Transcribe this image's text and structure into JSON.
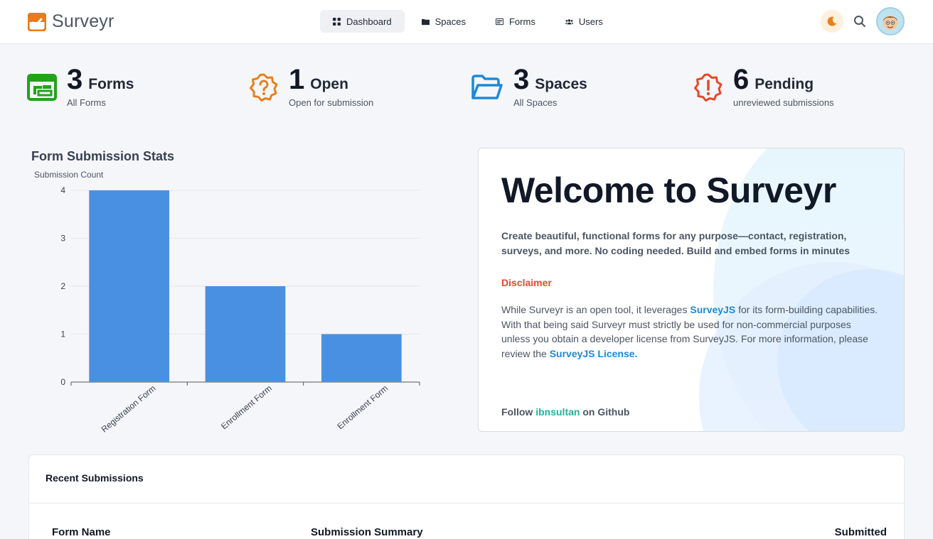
{
  "app": {
    "name": "Surveyr",
    "brand_color": "#ea7a1c",
    "accent_color": "#4a90e2"
  },
  "nav": {
    "items": [
      {
        "label": "Dashboard",
        "icon": "grid-icon",
        "active": true
      },
      {
        "label": "Spaces",
        "icon": "folder-icon",
        "active": false
      },
      {
        "label": "Forms",
        "icon": "form-icon",
        "active": false
      },
      {
        "label": "Users",
        "icon": "users-icon",
        "active": false
      }
    ]
  },
  "header": {
    "theme_icon": "moon-icon",
    "search_icon": "search-icon",
    "avatar_icon": "user-avatar"
  },
  "stats": [
    {
      "value": "3",
      "label": "Forms",
      "sub": "All Forms",
      "icon": "form-list-icon",
      "color": "#22a319"
    },
    {
      "value": "1",
      "label": "Open",
      "sub": "Open for submission",
      "icon": "question-badge-icon",
      "color": "#e8801c"
    },
    {
      "value": "3",
      "label": "Spaces",
      "sub": "All Spaces",
      "icon": "folder-open-icon",
      "color": "#1e88d8"
    },
    {
      "value": "6",
      "label": "Pending",
      "sub": "unreviewed submissions",
      "icon": "alert-badge-icon",
      "color": "#e5482d"
    }
  ],
  "chart": {
    "title": "Form Submission Stats"
  },
  "chart_data": {
    "type": "bar",
    "ylabel": "Submission Count",
    "xlabel": "",
    "categories": [
      "Registration Form",
      "Enrollment Form",
      "Enrollment Form"
    ],
    "values": [
      4,
      2,
      1
    ],
    "ylim": [
      0,
      4
    ],
    "yticks": [
      0,
      1,
      2,
      3,
      4
    ],
    "grid": true,
    "bar_color": "#4a90e2"
  },
  "welcome": {
    "title": "Welcome to Surveyr",
    "description": "Create beautiful, functional forms for any purpose—contact, registration, surveys, and more. No coding needed. Build and embed forms in minutes",
    "disclaimer_title": "Disclaimer",
    "disclaimer_part1": "While Surveyr is an open tool, it leverages ",
    "disclaimer_link1": "SurveyJS",
    "disclaimer_part2": " for its form-building capabilities. With that being said Surveyr must strictly be used for non-commercial purposes unless you obtain a developer license from SurveyJS. For more information, please review the ",
    "disclaimer_link2": "SurveyJS License.",
    "follow_prefix": "Follow ",
    "follow_user": "ibnsultan",
    "follow_suffix": " on Github"
  },
  "recent": {
    "title": "Recent Submissions",
    "columns": [
      "Form Name",
      "Submission Summary",
      "Submitted"
    ]
  }
}
